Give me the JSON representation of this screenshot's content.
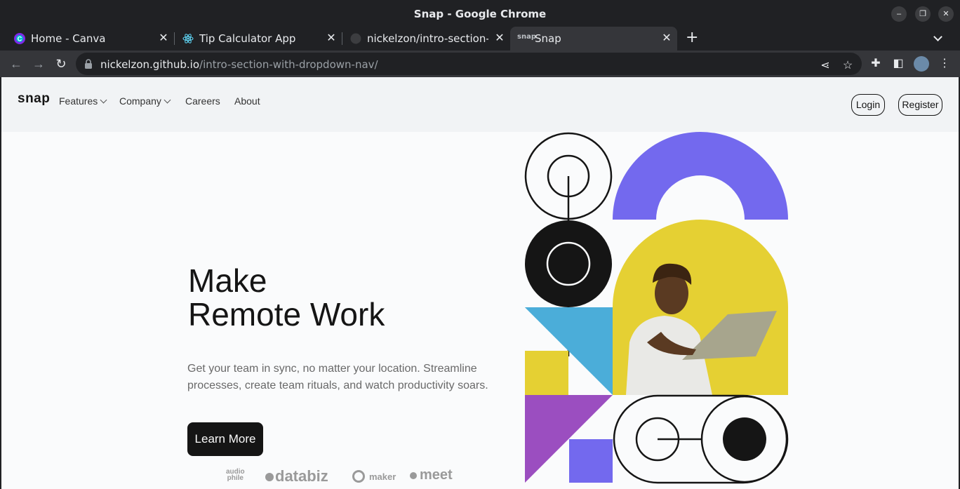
{
  "window": {
    "title": "Snap - Google Chrome"
  },
  "tabs": [
    {
      "label": "Home - Canva"
    },
    {
      "label": "Tip Calculator App"
    },
    {
      "label": "nickelzon/intro-section-w"
    },
    {
      "label": "Snap",
      "favicon_text": "snap"
    }
  ],
  "omnibox": {
    "host": "nickelzon.github.io",
    "path": "/intro-section-with-dropdown-nav/"
  },
  "site": {
    "logo": "snap",
    "nav": {
      "features": "Features",
      "company": "Company",
      "careers": "Careers",
      "about": "About"
    },
    "login": "Login",
    "register": "Register",
    "headline_line1": "Make",
    "headline_line2": "Remote Work",
    "subtext": "Get your team in sync, no matter your location. Streamline processes, create team rituals, and watch productivity soars.",
    "cta": "Learn More",
    "clients": {
      "audiophile_top": "audio",
      "audiophile_bottom": "phile",
      "databiz": "databiz",
      "maker": "maker",
      "meet": "meet"
    }
  },
  "colors": {
    "purple": "#7369ee",
    "yellow": "#e5d033",
    "blue": "#4badd9",
    "lavender": "#9b4ec0",
    "dark": "#151515"
  }
}
